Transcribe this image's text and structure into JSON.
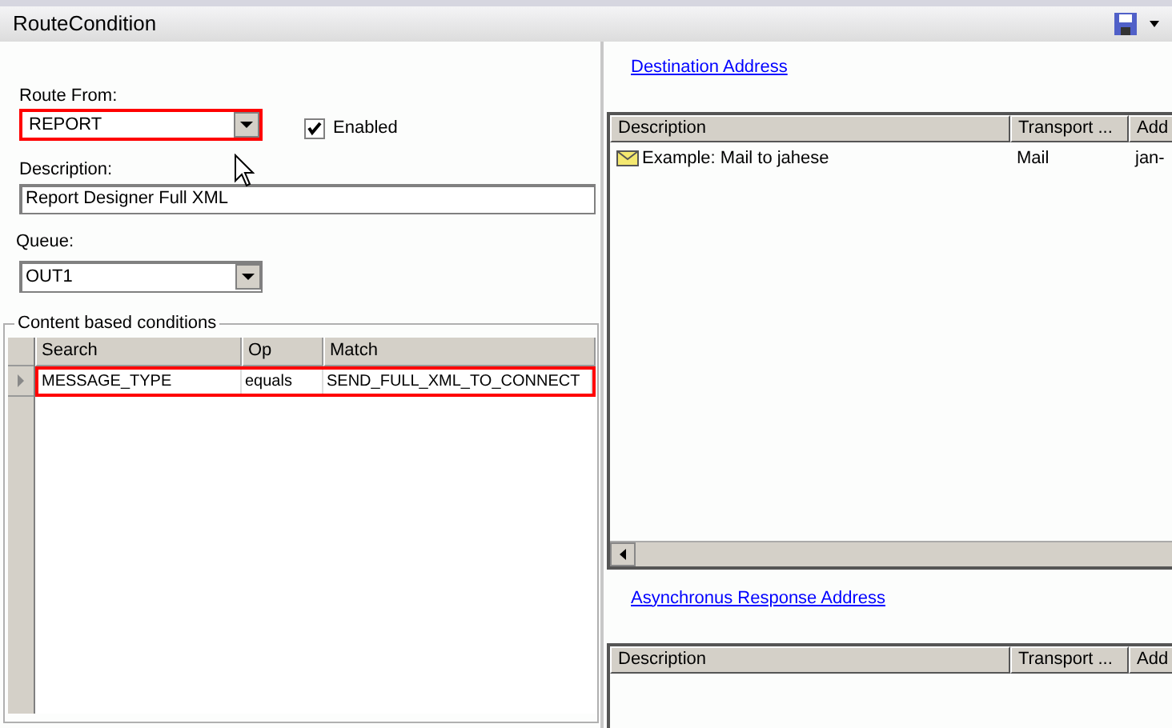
{
  "window": {
    "title": "RouteCondition"
  },
  "route_from": {
    "label": "Route From:",
    "value": "REPORT",
    "highlighted": true
  },
  "enabled": {
    "label": "Enabled",
    "checked": true
  },
  "description": {
    "label": "Description:",
    "value": "Report Designer Full XML"
  },
  "queue": {
    "label": "Queue:",
    "value": "OUT1"
  },
  "conditions": {
    "title": "Content based conditions",
    "columns": [
      "Search",
      "Op",
      "Match"
    ],
    "rows": [
      {
        "cells": [
          "MESSAGE_TYPE",
          "equals",
          "SEND_FULL_XML_TO_CONNECT"
        ],
        "highlighted": true
      }
    ]
  },
  "destination": {
    "link": "Destination Address",
    "columns": [
      "Description",
      "Transport ...",
      "Add"
    ],
    "rows": [
      {
        "cells": [
          "Example: Mail to jahese",
          "Mail",
          "jan-"
        ]
      }
    ]
  },
  "async_response": {
    "link": "Asynchronus Response Address",
    "columns": [
      "Description",
      "Transport ...",
      "Add"
    ]
  }
}
